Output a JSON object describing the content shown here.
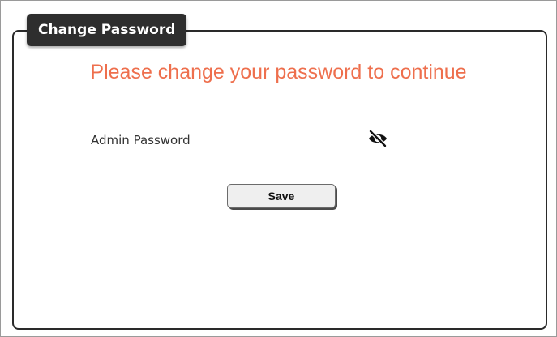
{
  "panel": {
    "title": "Change Password"
  },
  "notice": {
    "text": "Please change your password to continue",
    "color": "#ee6f4d"
  },
  "form": {
    "password_label": "Admin Password",
    "password_value": "",
    "password_placeholder": "",
    "visibility_icon": "eye-slash-icon",
    "save_label": "Save"
  }
}
